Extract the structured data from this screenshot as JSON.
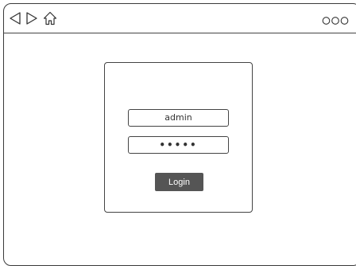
{
  "browser": {
    "nav": {
      "back_icon": "back-triangle-icon",
      "forward_icon": "forward-triangle-icon",
      "home_icon": "home-icon",
      "menu_icon": "more-options-icon"
    }
  },
  "login": {
    "username_value": "admin",
    "password_display": "•••••",
    "login_label": "Login",
    "button_color": "#555555"
  }
}
